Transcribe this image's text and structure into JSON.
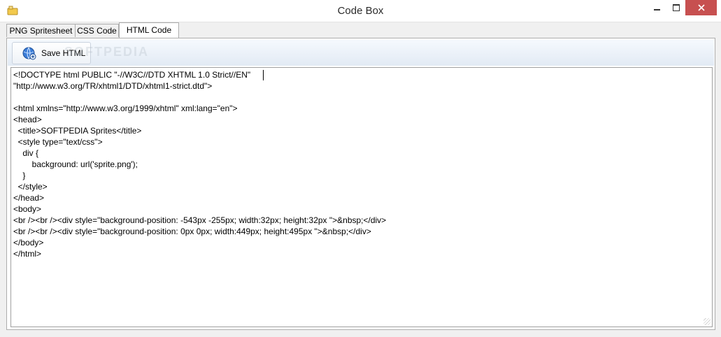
{
  "window": {
    "title": "Code Box",
    "icons": {
      "app": "app-icon",
      "minimize": "minimize-icon",
      "maximize": "maximize-icon",
      "close": "close-icon"
    }
  },
  "tabs": [
    {
      "label": "PNG Spritesheet",
      "active": false
    },
    {
      "label": "CSS Code",
      "active": false
    },
    {
      "label": "HTML Code",
      "active": true
    }
  ],
  "toolbar": {
    "save_label": "Save HTML",
    "save_icon": "globe-save-icon",
    "watermark": "SOFTPEDIA"
  },
  "editor": {
    "lines": [
      "<!DOCTYPE html PUBLIC \"-//W3C//DTD XHTML 1.0 Strict//EN\"",
      "\"http://www.w3.org/TR/xhtml1/DTD/xhtml1-strict.dtd\">",
      "",
      "<html xmlns=\"http://www.w3.org/1999/xhtml\" xml:lang=\"en\">",
      "<head>",
      "  <title>SOFTPEDIA Sprites</title>",
      "  <style type=\"text/css\">",
      "    div {",
      "        background: url('sprite.png');",
      "    }",
      "  </style>",
      "</head>",
      "<body>",
      "<br /><br /><div style=\"background-position: -543px -255px; width:32px; height:32px \">&nbsp;</div>",
      "<br /><br /><div style=\"background-position: 0px 0px; width:449px; height:495px \">&nbsp;</div>",
      "</body>",
      "</html>"
    ]
  },
  "colors": {
    "close_button": "#c75050",
    "toolbar_top": "#f6fafe",
    "toolbar_bottom": "#e2eaf4"
  }
}
